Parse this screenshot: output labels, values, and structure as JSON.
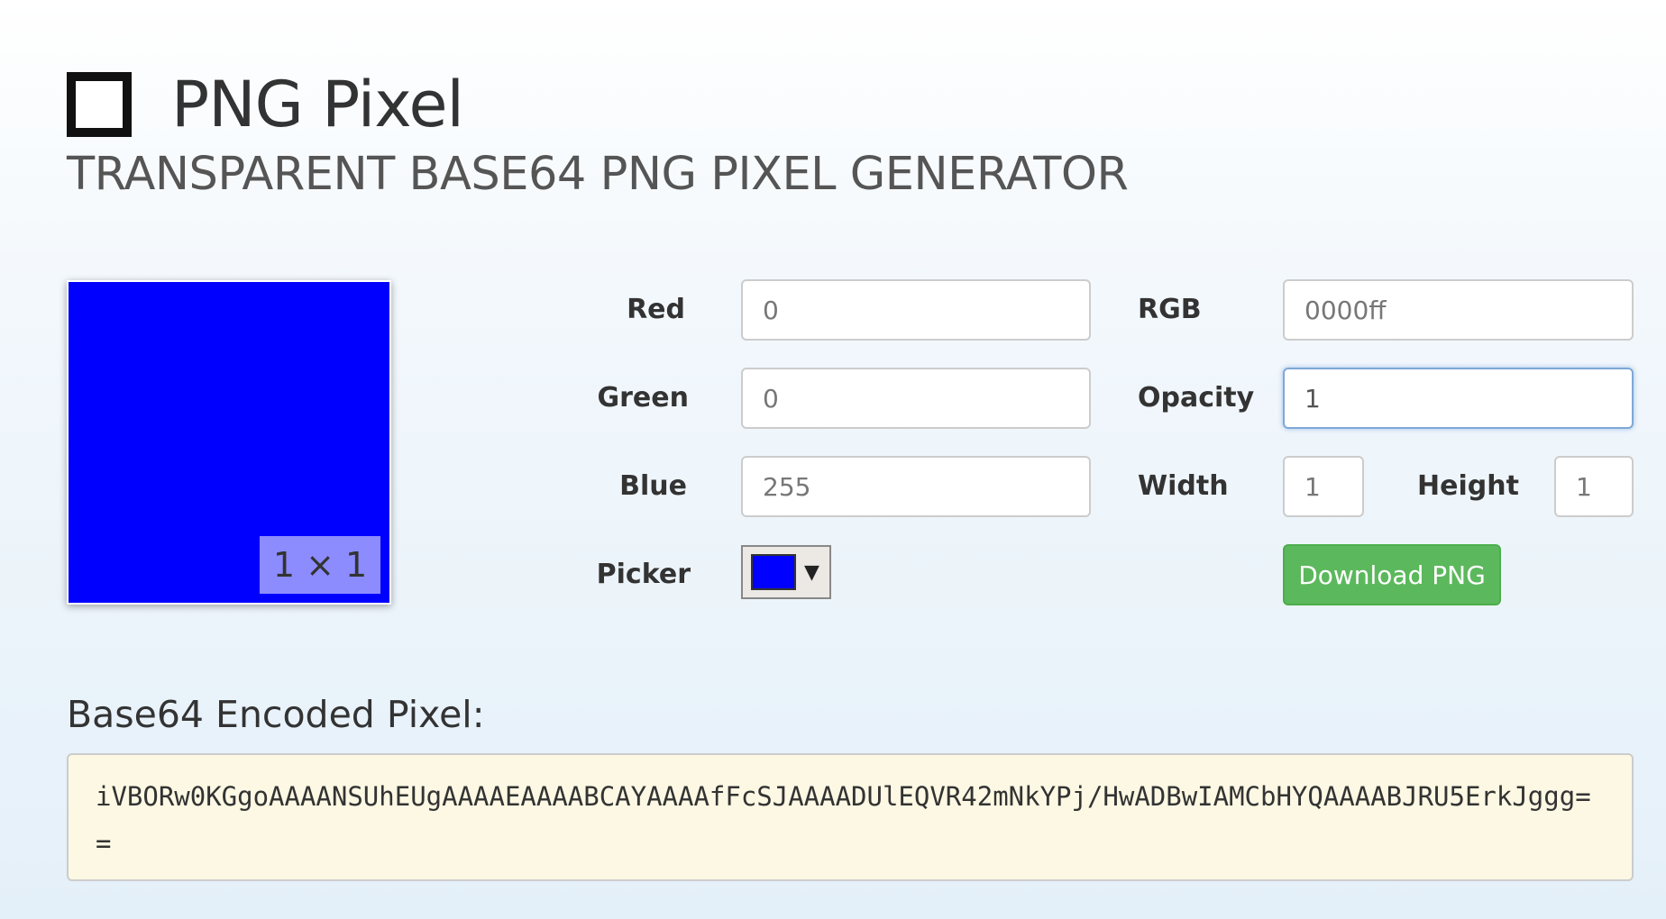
{
  "header": {
    "title": "PNG Pixel",
    "subtitle": "TRANSPARENT BASE64 PNG PIXEL GENERATOR"
  },
  "preview": {
    "color": "#0000ff",
    "size_label": "1 × 1"
  },
  "form": {
    "red_label": "Red",
    "red_value": "0",
    "green_label": "Green",
    "green_value": "0",
    "blue_label": "Blue",
    "blue_value": "255",
    "picker_label": "Picker",
    "picker_color": "#0000ff",
    "picker_arrow": "▼",
    "rgb_label": "RGB",
    "rgb_value": "0000ff",
    "opacity_label": "Opacity",
    "opacity_value": "1",
    "width_label": "Width",
    "width_value": "1",
    "height_label": "Height",
    "height_value": "1",
    "download_label": "Download PNG"
  },
  "output": {
    "title": "Base64 Encoded Pixel:",
    "base64": "iVBORw0KGgoAAAANSUhEUgAAAAEAAAABCAYAAAAfFcSJAAAADUlEQVR42mNkYPj/HwADBwIAMCbHYQAAAABJRU5ErkJggg=="
  },
  "colors": {
    "accent_green": "#5cb85c",
    "code_background": "#fcf8e3",
    "focus_border": "#7fa8d6"
  }
}
